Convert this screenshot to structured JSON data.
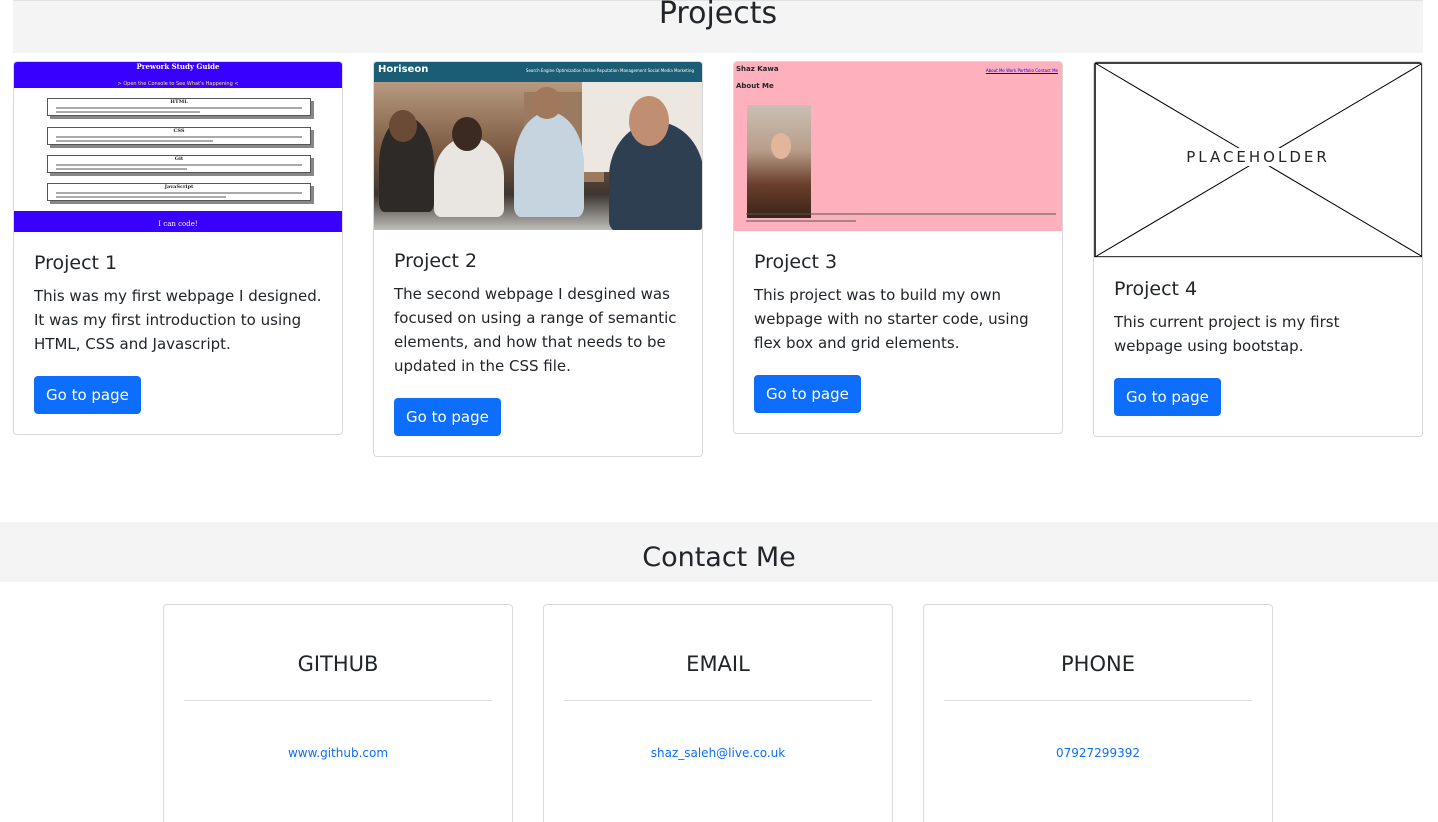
{
  "projects": {
    "title": "Projects",
    "button_label": "Go to page",
    "cards": [
      {
        "title": "Project 1",
        "text": "This was my first webpage I designed. It was my first introduction to using HTML, CSS and Javascript."
      },
      {
        "title": "Project 2",
        "text": "The second webpage I desgined was focused on using a range of semantic elements, and how that needs to be updated in the CSS file."
      },
      {
        "title": "Project 3",
        "text": "This project was to build my own webpage with no starter code, using flex box and grid elements."
      },
      {
        "title": "Project 4",
        "text": "This current project is my first webpage using bootstap."
      }
    ]
  },
  "thumb1": {
    "title": "Prework Study Guide",
    "subtitle": "> Open the Console to See What's Happening <",
    "sections": [
      "HTML",
      "CSS",
      "Git",
      "JavaScript"
    ],
    "footer": "I can code!"
  },
  "thumb2": {
    "brand": "Horiseon",
    "nav": "Search Engine Optimization    Online Reputation Management    Social Media Marketing"
  },
  "thumb3": {
    "name": "Shaz Kawa",
    "about": "About Me",
    "links": "About Me   Work   Portfolio   Contact Me"
  },
  "thumb4": {
    "label": "PLACEHOLDER"
  },
  "contact": {
    "title": "Contact Me",
    "cards": [
      {
        "label": "GITHUB",
        "link": "www.github.com"
      },
      {
        "label": "EMAIL",
        "link": "shaz_saleh@live.co.uk"
      },
      {
        "label": "PHONE",
        "link": "07927299392"
      }
    ]
  },
  "colors": {
    "primary": "#0d6efd",
    "section_bg": "#f4f4f4",
    "prework_purple": "#3700ff",
    "horiseon_teal": "#1c5d76",
    "pink": "#ffb0bd"
  }
}
